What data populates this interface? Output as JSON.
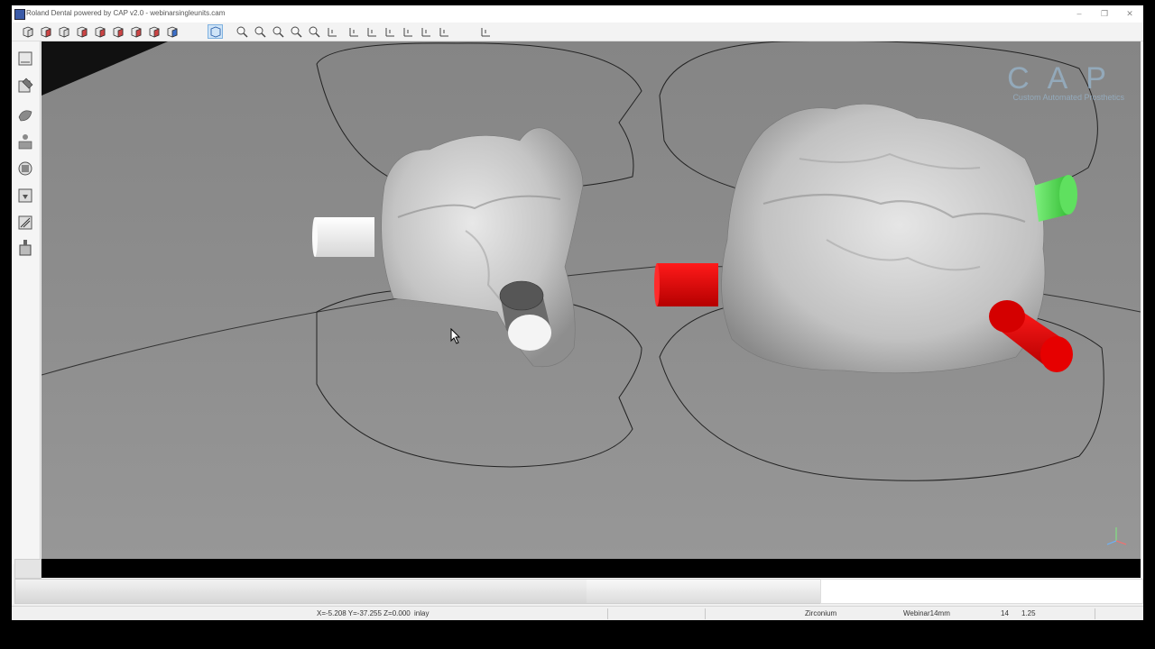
{
  "window": {
    "title": "Roland Dental powered by CAP v2.0  -  webinarsingleunits.cam",
    "minimize": "–",
    "restore": "❐",
    "close": "✕"
  },
  "toolbar": {
    "icons": [
      "view-front-icon",
      "view-back-icon",
      "view-left-icon",
      "view-right-icon",
      "view-top-icon",
      "view-bottom-icon",
      "view-iso1-icon",
      "view-iso2-icon",
      "view-iso3-icon",
      "wireframe-toggle-icon",
      "zoom-window-icon",
      "zoom-out-icon",
      "pan-icon",
      "rotate-icon",
      "fit-icon",
      "measure-icon",
      "section-x-icon",
      "section-y-icon",
      "section-z-icon",
      "clip-icon",
      "sprue-icon",
      "tool-icon",
      "settings-icon"
    ]
  },
  "left_toolbar": {
    "icons": [
      "new-job-icon",
      "edit-icon",
      "material-icon",
      "nesting-icon",
      "stock-icon",
      "calculate-icon",
      "simulate-icon",
      "mill-icon"
    ]
  },
  "viewport": {
    "logo_text": "CAP",
    "logo_subtitle": "Custom Automated Prosthetics",
    "colors": {
      "background": "#8a8a8a",
      "model": "#d4d4d4",
      "connector_white": "#f2f2f2",
      "connector_red": "#d10000",
      "connector_green": "#4fd84f"
    }
  },
  "progress": {
    "value": 0.71
  },
  "statusbar": {
    "coordinates": "X=-5.208 Y=-37.255 Z=0.000",
    "job_type": "inlay",
    "material": "Zirconium",
    "stock": "Webinar14mm",
    "field_a": "14",
    "field_b": "1.25"
  }
}
